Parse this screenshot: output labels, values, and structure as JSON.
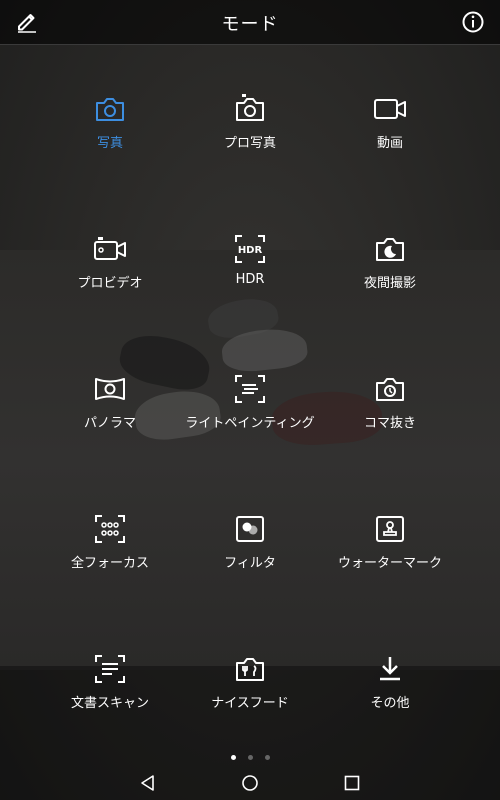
{
  "header": {
    "title": "モード"
  },
  "modes": [
    {
      "label": "写真",
      "icon": "camera-icon",
      "active": true
    },
    {
      "label": "プロ写真",
      "icon": "pro-camera-icon"
    },
    {
      "label": "動画",
      "icon": "video-icon"
    },
    {
      "label": "プロビデオ",
      "icon": "pro-video-icon"
    },
    {
      "label": "HDR",
      "icon": "hdr-icon"
    },
    {
      "label": "夜間撮影",
      "icon": "night-icon"
    },
    {
      "label": "パノラマ",
      "icon": "panorama-icon"
    },
    {
      "label": "ライトペインティング",
      "icon": "light-painting-icon"
    },
    {
      "label": "コマ抜き",
      "icon": "time-lapse-icon"
    },
    {
      "label": "全フォーカス",
      "icon": "all-focus-icon"
    },
    {
      "label": "フィルタ",
      "icon": "filter-icon"
    },
    {
      "label": "ウォーターマーク",
      "icon": "watermark-icon"
    },
    {
      "label": "文書スキャン",
      "icon": "document-scan-icon"
    },
    {
      "label": "ナイスフード",
      "icon": "good-food-icon"
    },
    {
      "label": "その他",
      "icon": "download-icon"
    }
  ],
  "pager": {
    "current": 1,
    "total": 3
  },
  "colors": {
    "accent": "#3d8ee0",
    "text": "#ffffff"
  }
}
